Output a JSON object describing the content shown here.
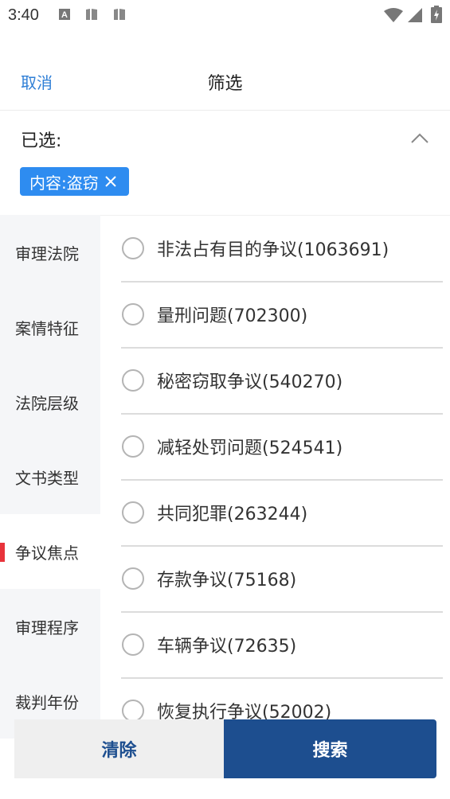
{
  "status_bar": {
    "time": "3:40",
    "icons": [
      "a-notification-icon",
      "sim-card-icon",
      "sim-card-icon",
      "wifi-icon",
      "cell-signal-icon",
      "battery-icon"
    ]
  },
  "header": {
    "cancel_label": "取消",
    "title": "筛选"
  },
  "selected": {
    "label": "已选:",
    "chips": [
      {
        "text": "内容:盗窃"
      }
    ]
  },
  "sidebar": {
    "items": [
      {
        "label": "审理法院",
        "active": false
      },
      {
        "label": "案情特征",
        "active": false
      },
      {
        "label": "法院层级",
        "active": false
      },
      {
        "label": "文书类型",
        "active": false
      },
      {
        "label": "争议焦点",
        "active": true
      },
      {
        "label": "审理程序",
        "active": false
      },
      {
        "label": "裁判年份",
        "active": false
      }
    ]
  },
  "options": [
    {
      "label": "非法占有目的争议(1063691)"
    },
    {
      "label": "量刑问题(702300)"
    },
    {
      "label": "秘密窃取争议(540270)"
    },
    {
      "label": "减轻处罚问题(524541)"
    },
    {
      "label": "共同犯罪(263244)"
    },
    {
      "label": "存款争议(75168)"
    },
    {
      "label": "车辆争议(72635)"
    },
    {
      "label": "恢复执行争议(52002)"
    }
  ],
  "buttons": {
    "clear_label": "清除",
    "search_label": "搜索"
  },
  "colors": {
    "accent": "#2f7fd6",
    "chip": "#2e8cf0",
    "primary": "#1d4e8f",
    "active_marker": "#e8333b"
  }
}
